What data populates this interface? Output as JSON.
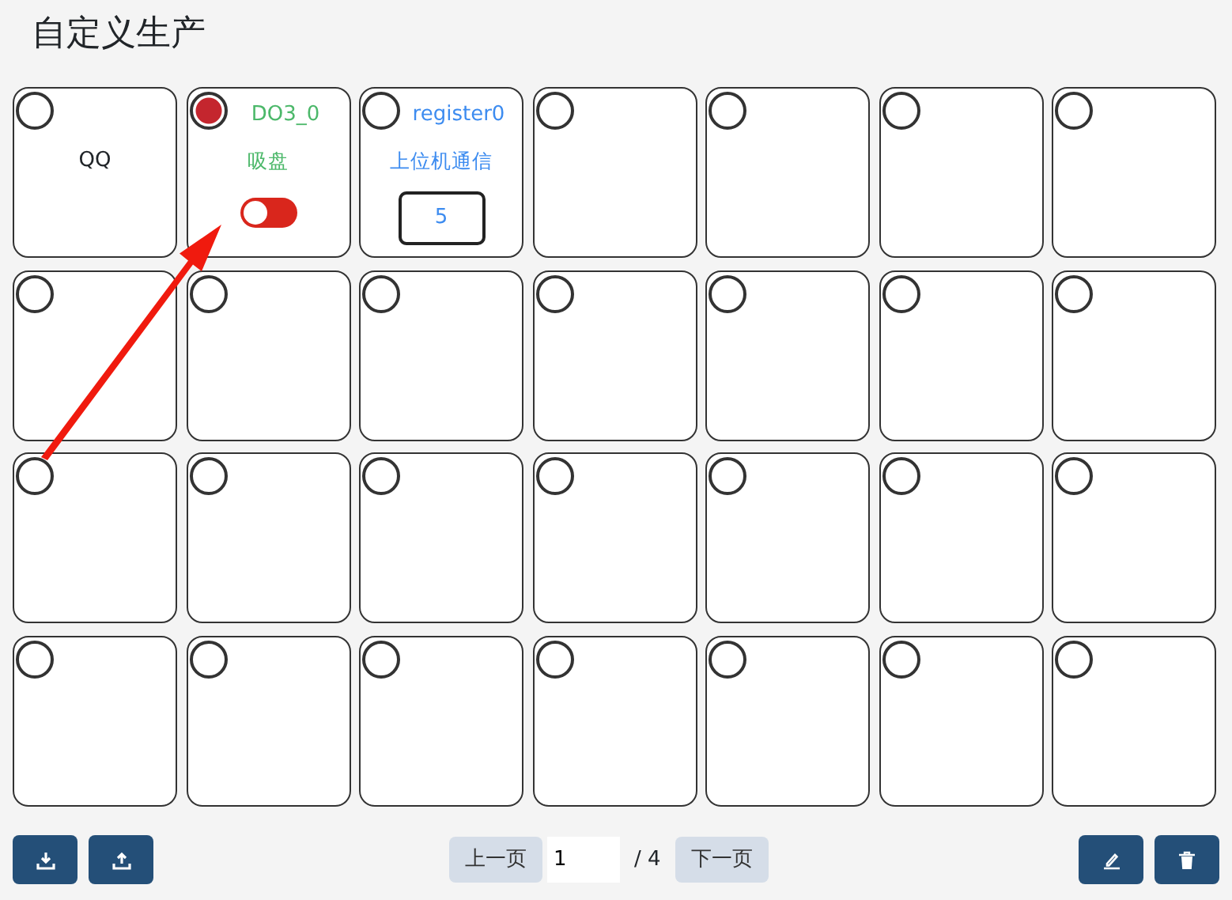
{
  "title": "自定义生产",
  "cells": [
    {
      "kind": "label",
      "selected": false,
      "label": "QQ"
    },
    {
      "kind": "switch",
      "selected": true,
      "name": "DO3_0",
      "label": "吸盘",
      "on": false
    },
    {
      "kind": "register",
      "selected": false,
      "name": "register0",
      "label": "上位机通信",
      "value": "5"
    },
    {
      "kind": "empty",
      "selected": false
    },
    {
      "kind": "empty",
      "selected": false
    },
    {
      "kind": "empty",
      "selected": false
    },
    {
      "kind": "empty",
      "selected": false
    },
    {
      "kind": "empty",
      "selected": false
    },
    {
      "kind": "empty",
      "selected": false
    },
    {
      "kind": "empty",
      "selected": false
    },
    {
      "kind": "empty",
      "selected": false
    },
    {
      "kind": "empty",
      "selected": false
    },
    {
      "kind": "empty",
      "selected": false
    },
    {
      "kind": "empty",
      "selected": false
    },
    {
      "kind": "empty",
      "selected": false
    },
    {
      "kind": "empty",
      "selected": false
    },
    {
      "kind": "empty",
      "selected": false
    },
    {
      "kind": "empty",
      "selected": false
    },
    {
      "kind": "empty",
      "selected": false
    },
    {
      "kind": "empty",
      "selected": false
    },
    {
      "kind": "empty",
      "selected": false
    },
    {
      "kind": "empty",
      "selected": false
    },
    {
      "kind": "empty",
      "selected": false
    },
    {
      "kind": "empty",
      "selected": false
    },
    {
      "kind": "empty",
      "selected": false
    },
    {
      "kind": "empty",
      "selected": false
    },
    {
      "kind": "empty",
      "selected": false
    },
    {
      "kind": "empty",
      "selected": false
    }
  ],
  "pager": {
    "prev": "上一页",
    "page": "1",
    "total": "/ 4",
    "next": "下一页"
  }
}
